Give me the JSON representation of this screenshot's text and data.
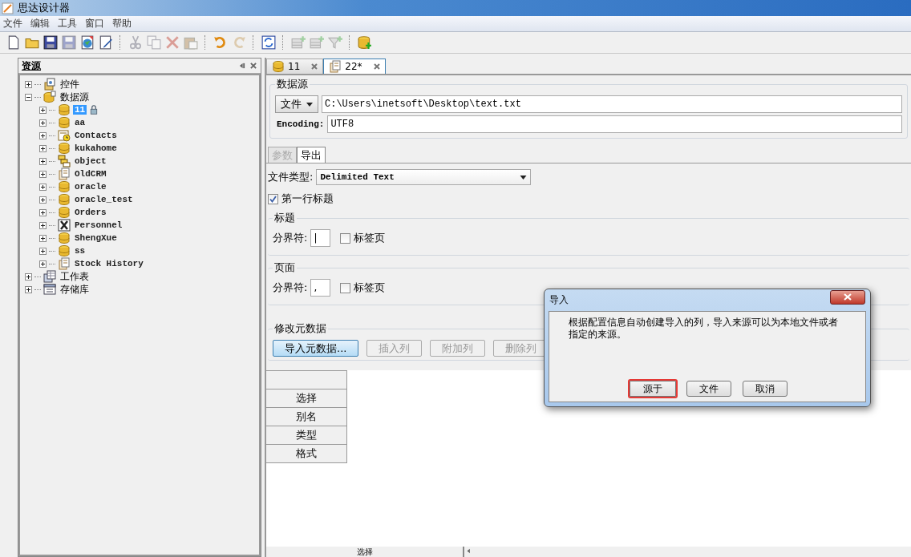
{
  "window": {
    "title": "思达设计器"
  },
  "menu": [
    "文件",
    "编辑",
    "工具",
    "窗口",
    "帮助"
  ],
  "toolbar": [
    {
      "kind": "new",
      "disabled": false
    },
    {
      "kind": "open",
      "disabled": false
    },
    {
      "kind": "save",
      "disabled": false
    },
    {
      "kind": "save",
      "disabled": true
    },
    {
      "kind": "globe",
      "disabled": false
    },
    {
      "kind": "edit",
      "disabled": false
    },
    {
      "kind": "sep"
    },
    {
      "kind": "cut",
      "disabled": true
    },
    {
      "kind": "copy",
      "disabled": true
    },
    {
      "kind": "delete",
      "disabled": true
    },
    {
      "kind": "paste",
      "disabled": true
    },
    {
      "kind": "sep"
    },
    {
      "kind": "undo",
      "disabled": false
    },
    {
      "kind": "redo",
      "disabled": true
    },
    {
      "kind": "sep"
    },
    {
      "kind": "refresh",
      "disabled": false
    },
    {
      "kind": "sep"
    },
    {
      "kind": "add-table",
      "disabled": true
    },
    {
      "kind": "add-table",
      "disabled": true
    },
    {
      "kind": "filter",
      "disabled": true
    },
    {
      "kind": "sep"
    },
    {
      "kind": "add-db",
      "disabled": false
    }
  ],
  "resource_panel": {
    "title": "资源",
    "tree": [
      {
        "label": "控件",
        "kind": "controls",
        "expanded": false,
        "selected": false
      },
      {
        "label": "数据源",
        "kind": "datasource",
        "expanded": true,
        "selected": false,
        "children": [
          {
            "label": "11",
            "kind": "db",
            "expanded": false,
            "selected": true,
            "locked": true
          },
          {
            "label": "aa",
            "kind": "db",
            "expanded": false,
            "selected": false,
            "locked": false
          },
          {
            "label": "Contacts",
            "kind": "contacts",
            "expanded": false,
            "selected": false,
            "locked": false
          },
          {
            "label": "kukahome",
            "kind": "db",
            "expanded": false,
            "selected": false,
            "locked": false
          },
          {
            "label": "object",
            "kind": "objects",
            "expanded": false,
            "selected": false,
            "locked": false
          },
          {
            "label": "OldCRM",
            "kind": "document",
            "expanded": false,
            "selected": false,
            "locked": false
          },
          {
            "label": "oracle",
            "kind": "db",
            "expanded": false,
            "selected": false,
            "locked": false
          },
          {
            "label": "oracle_test",
            "kind": "db",
            "expanded": false,
            "selected": false,
            "locked": false
          },
          {
            "label": "Orders",
            "kind": "db",
            "expanded": false,
            "selected": false,
            "locked": false
          },
          {
            "label": "Personnel",
            "kind": "excel",
            "expanded": false,
            "selected": false,
            "locked": false
          },
          {
            "label": "ShengXue",
            "kind": "db",
            "expanded": false,
            "selected": false,
            "locked": false
          },
          {
            "label": "ss",
            "kind": "db",
            "expanded": false,
            "selected": false,
            "locked": false
          },
          {
            "label": "Stock History",
            "kind": "document",
            "expanded": false,
            "selected": false,
            "locked": false
          }
        ]
      },
      {
        "label": "工作表",
        "kind": "worksheet",
        "expanded": false,
        "selected": false
      },
      {
        "label": "存储库",
        "kind": "storage",
        "expanded": false,
        "selected": false
      }
    ]
  },
  "editor_tabs": [
    {
      "label": "11",
      "kind": "db",
      "selected": false
    },
    {
      "label": "22*",
      "kind": "document",
      "selected": true
    }
  ],
  "datasource": {
    "title": "数据源",
    "type_button": "文件",
    "path": "C:\\Users\\inetsoft\\Desktop\\text.txt",
    "encoding_label": "Encoding:",
    "encoding": "UTF8"
  },
  "sub_tabs": [
    {
      "label": "参数",
      "selected": false
    },
    {
      "label": "导出",
      "selected": true
    }
  ],
  "export": {
    "file_type_label": "文件类型:",
    "file_type": "Delimited Text",
    "first_row_header": {
      "label": "第一行标题",
      "checked": true
    },
    "groups": [
      {
        "title": "标题",
        "separator_label": "分界符:",
        "separator": "|",
        "tab_label": "标签页",
        "tab_checked": false
      },
      {
        "title": "页面",
        "separator_label": "分界符:",
        "separator": ",",
        "tab_label": "标签页",
        "tab_checked": false
      }
    ],
    "metadata": {
      "title": "修改元数据",
      "buttons": [
        {
          "label": "导入元数据...",
          "disabled": false
        },
        {
          "label": "插入列",
          "disabled": true
        },
        {
          "label": "附加列",
          "disabled": true
        },
        {
          "label": "删除列",
          "disabled": true
        }
      ]
    }
  },
  "row_headers": [
    "选择",
    "别名",
    "类型",
    "格式"
  ],
  "bottom_bar": {
    "column_header": "选择"
  },
  "dialog": {
    "title": "导入",
    "message": "根据配置信息自动创建导入的列，导入来源可以为本地文件或者指定的来源。",
    "buttons": [
      {
        "label": "源于",
        "focused": true
      },
      {
        "label": "文件",
        "focused": false
      },
      {
        "label": "取消",
        "focused": false
      }
    ]
  }
}
